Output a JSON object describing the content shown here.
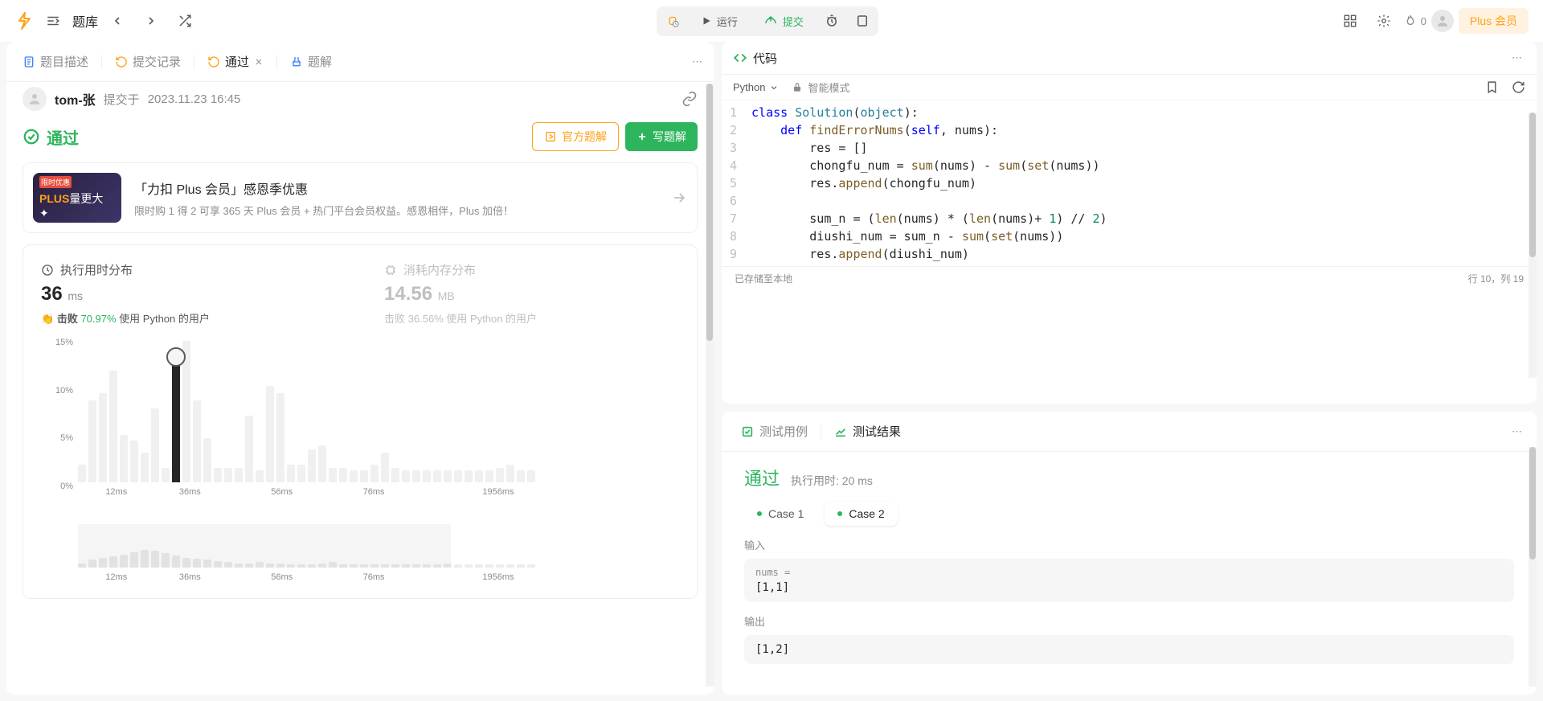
{
  "topnav": {
    "problem_bank": "题库",
    "run_label": "运行",
    "submit_label": "提交",
    "streak_count": "0",
    "plus_label": "Plus 会员"
  },
  "left": {
    "tabs": {
      "desc": "题目描述",
      "submissions": "提交记录",
      "accepted": "通过",
      "solutions": "题解"
    },
    "user": {
      "name": "tom-张",
      "meta1": "提交于",
      "meta2": "2023.11.23 16:45"
    },
    "status_label": "通过",
    "buttons": {
      "official": "官方题解",
      "write": "写题解"
    },
    "promo": {
      "img_tag": "限时优惠",
      "img_line1": "PLUS",
      "img_line2": "量更大",
      "heading": "「力扣 Plus 会员」感恩季优惠",
      "sub": "限时购 1 得 2 可享 365 天 Plus 会员 + 热门平台会员权益。感恩相伴，Plus 加倍！"
    },
    "stats": {
      "time_title": "执行用时分布",
      "time_value": "36",
      "time_unit": "ms",
      "time_beat_label": "击败",
      "time_beat_pct": "70.97%",
      "time_beat_tail": "使用 Python 的用户",
      "mem_title": "消耗内存分布",
      "mem_value": "14.56",
      "mem_unit": "MB",
      "mem_beat_label": "击败",
      "mem_beat_pct": "36.56%",
      "mem_beat_tail": "使用 Python 的用户"
    },
    "chart_data": {
      "type": "bar",
      "ylabels": [
        "15%",
        "10%",
        "5%",
        "0%"
      ],
      "xlabels": [
        "12ms",
        "36ms",
        "56ms",
        "76ms",
        "1956ms"
      ],
      "bars_pct": [
        12,
        55,
        60,
        75,
        32,
        28,
        20,
        50,
        10,
        80,
        95,
        55,
        30,
        10,
        10,
        10,
        45,
        8,
        65,
        60,
        12,
        12,
        22,
        25,
        10,
        10,
        8,
        8,
        12,
        20,
        10,
        8,
        8,
        8,
        8,
        8,
        8,
        8,
        8,
        8,
        10,
        12,
        8,
        8
      ],
      "active_index": 9,
      "mini_bars_pct": [
        10,
        18,
        22,
        25,
        30,
        35,
        40,
        38,
        32,
        28,
        22,
        20,
        18,
        15,
        12,
        10,
        10,
        12,
        10,
        10,
        8,
        8,
        8,
        10,
        12,
        8,
        8,
        8,
        8,
        8,
        8,
        8,
        8,
        8,
        8,
        10,
        8,
        8,
        8,
        8,
        8,
        8,
        8,
        8
      ],
      "mini_highlight": {
        "left": 0,
        "width": 62
      }
    }
  },
  "code": {
    "title": "代码",
    "lang": "Python",
    "mode_label": "智能模式",
    "lines": [
      "class Solution(object):",
      "    def findErrorNums(self, nums):",
      "        res = []",
      "        chongfu_num = sum(nums) - sum(set(nums))",
      "        res.append(chongfu_num)",
      "",
      "        sum_n = (len(nums) * (len(nums)+ 1) // 2)",
      "        diushi_num = sum_n - sum(set(nums))",
      "        res.append(diushi_num)"
    ],
    "saved_text": "已存储至本地",
    "cursor_text": "行 10，列 19"
  },
  "result": {
    "tab_cases": "测试用例",
    "tab_result": "测试结果",
    "status": "通过",
    "runtime_label": "执行用时: 20 ms",
    "case1": "Case 1",
    "case2": "Case 2",
    "input_label": "输入",
    "nums_label": "nums =",
    "nums_value": "[1,1]",
    "output_label": "输出",
    "output_value": "[1,2]"
  }
}
